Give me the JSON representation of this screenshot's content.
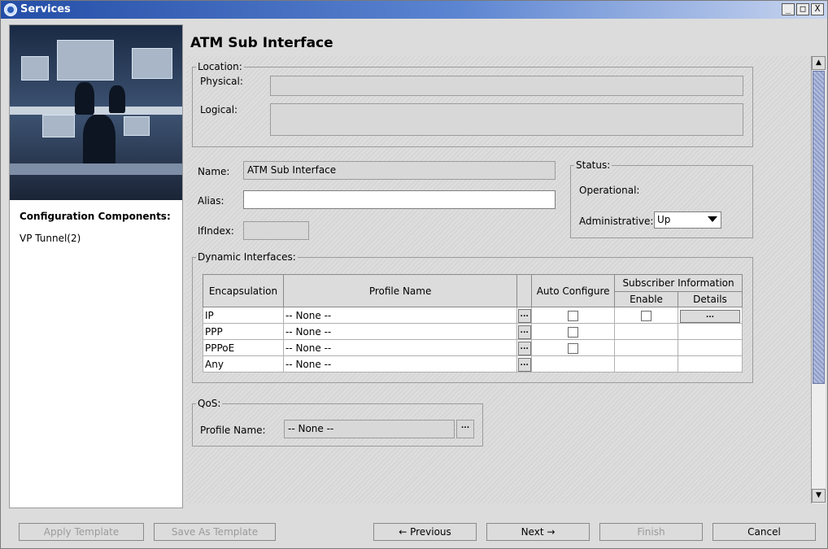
{
  "window": {
    "title": "Services",
    "controls": [
      "_",
      "□",
      "X"
    ]
  },
  "left": {
    "config_title": "Configuration Components:",
    "items": [
      "VP Tunnel(2)"
    ]
  },
  "main": {
    "page_title": "ATM Sub Interface",
    "location": {
      "legend": "Location:",
      "physical_label": "Physical:",
      "physical_value": "",
      "logical_label": "Logical:",
      "logical_value": ""
    },
    "name_label": "Name:",
    "name_value": "ATM Sub Interface",
    "alias_label": "Alias:",
    "alias_value": "",
    "ifindex_label": "IfIndex:",
    "ifindex_value": "",
    "status": {
      "legend": "Status:",
      "operational_label": "Operational:",
      "operational_value": "",
      "administrative_label": "Administrative:",
      "administrative_value": "Up"
    },
    "dynamic": {
      "legend": "Dynamic Interfaces:",
      "headers": {
        "encapsulation": "Encapsulation",
        "profile_name": "Profile Name",
        "auto_configure": "Auto Configure",
        "subscriber_info": "Subscriber Information",
        "enable": "Enable",
        "details": "Details"
      },
      "rows": [
        {
          "encapsulation": "IP",
          "profile": "-- None --",
          "auto_configure": false,
          "enable": false,
          "has_details": true
        },
        {
          "encapsulation": "PPP",
          "profile": "-- None --",
          "auto_configure": false,
          "enable": null,
          "has_details": false
        },
        {
          "encapsulation": "PPPoE",
          "profile": "-- None --",
          "auto_configure": false,
          "enable": null,
          "has_details": false
        },
        {
          "encapsulation": "Any",
          "profile": "-- None --",
          "auto_configure": null,
          "enable": null,
          "has_details": false
        }
      ],
      "ellipsis": "..."
    },
    "qos": {
      "legend": "QoS:",
      "profile_label": "Profile Name:",
      "profile_value": "-- None --",
      "ellipsis": "..."
    }
  },
  "buttons": {
    "apply_template": "Apply Template",
    "save_as_template": "Save As Template",
    "previous": "Previous",
    "next": "Next",
    "finish": "Finish",
    "cancel": "Cancel"
  },
  "icons": {
    "prev_arrow": "←",
    "next_arrow": "→"
  }
}
